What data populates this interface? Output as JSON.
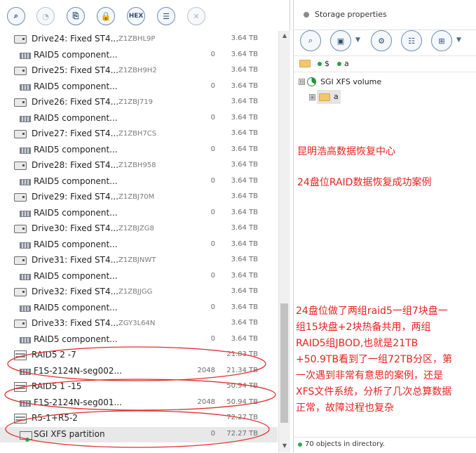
{
  "left_toolbar": {
    "buttons": [
      {
        "name": "search-button",
        "glyph": "⌕"
      },
      {
        "name": "chart-button",
        "glyph": "◔"
      },
      {
        "name": "image-button",
        "glyph": "⎘"
      },
      {
        "name": "lock-button",
        "glyph": "🔒"
      },
      {
        "name": "hex-button",
        "glyph": "HEX"
      },
      {
        "name": "list-button",
        "glyph": "☰"
      },
      {
        "name": "close-button",
        "glyph": "✕"
      }
    ]
  },
  "device_list": [
    {
      "kind": "drive",
      "name": "Drive24: Fixed ST4...",
      "serial": "Z1ZBHL9P",
      "num": "",
      "size": "3.64 TB"
    },
    {
      "kind": "component",
      "name": "RAID5 component...",
      "serial": "",
      "num": "0",
      "size": "3.64 TB"
    },
    {
      "kind": "drive",
      "name": "Drive25: Fixed ST4...",
      "serial": "Z1ZBH9H2",
      "num": "",
      "size": "3.64 TB"
    },
    {
      "kind": "component",
      "name": "RAID5 component...",
      "serial": "",
      "num": "0",
      "size": "3.64 TB"
    },
    {
      "kind": "drive",
      "name": "Drive26: Fixed ST4...",
      "serial": "Z1ZBJ719",
      "num": "",
      "size": "3.64 TB"
    },
    {
      "kind": "component",
      "name": "RAID5 component...",
      "serial": "",
      "num": "0",
      "size": "3.64 TB"
    },
    {
      "kind": "drive",
      "name": "Drive27: Fixed ST4...",
      "serial": "Z1ZBH7CS",
      "num": "",
      "size": "3.64 TB"
    },
    {
      "kind": "component",
      "name": "RAID5 component...",
      "serial": "",
      "num": "0",
      "size": "3.64 TB"
    },
    {
      "kind": "drive",
      "name": "Drive28: Fixed ST4...",
      "serial": "Z1ZBH958",
      "num": "",
      "size": "3.64 TB"
    },
    {
      "kind": "component",
      "name": "RAID5 component...",
      "serial": "",
      "num": "0",
      "size": "3.64 TB"
    },
    {
      "kind": "drive",
      "name": "Drive29: Fixed ST4...",
      "serial": "Z1ZBJ70M",
      "num": "",
      "size": "3.64 TB"
    },
    {
      "kind": "component",
      "name": "RAID5 component...",
      "serial": "",
      "num": "0",
      "size": "3.64 TB"
    },
    {
      "kind": "drive",
      "name": "Drive30: Fixed ST4...",
      "serial": "Z1ZBJZG8",
      "num": "",
      "size": "3.64 TB"
    },
    {
      "kind": "component",
      "name": "RAID5 component...",
      "serial": "",
      "num": "0",
      "size": "3.64 TB"
    },
    {
      "kind": "drive",
      "name": "Drive31: Fixed ST4...",
      "serial": "Z1ZBJNWT",
      "num": "",
      "size": "3.64 TB"
    },
    {
      "kind": "component",
      "name": "RAID5 component...",
      "serial": "",
      "num": "0",
      "size": "3.64 TB"
    },
    {
      "kind": "drive",
      "name": "Drive32: Fixed ST4...",
      "serial": "Z1ZBJJGG",
      "num": "",
      "size": "3.64 TB"
    },
    {
      "kind": "component",
      "name": "RAID5 component...",
      "serial": "",
      "num": "0",
      "size": "3.64 TB"
    },
    {
      "kind": "drive",
      "name": "Drive33: Fixed ST4...",
      "serial": "ZGY3L64N",
      "num": "",
      "size": "3.64 TB"
    },
    {
      "kind": "component",
      "name": "RAID5 component...",
      "serial": "",
      "num": "0",
      "size": "3.64 TB"
    },
    {
      "kind": "raid",
      "name": "RAID5 2 -7",
      "serial": "",
      "num": "",
      "size": "21.83 TB"
    },
    {
      "kind": "component",
      "name": "F1S-2124N-seg002...",
      "serial": "",
      "num": "2048",
      "size": "21.34 TB"
    },
    {
      "kind": "raid",
      "name": "RAID5 1 -15",
      "serial": "",
      "num": "",
      "size": "50.94 TB"
    },
    {
      "kind": "component",
      "name": "F1S-2124N-seg001...",
      "serial": "",
      "num": "2048",
      "size": "50.94 TB"
    },
    {
      "kind": "raid",
      "name": "R5-1+R5-2",
      "serial": "",
      "num": "",
      "size": "72.27 TB"
    },
    {
      "kind": "partition",
      "name": "SGI XFS partition",
      "serial": "",
      "num": "0",
      "size": "72.27 TB"
    }
  ],
  "right_panel": {
    "title": "Storage properties",
    "path": [
      "$",
      "a"
    ],
    "tree": {
      "root_label": "SGI XFS volume",
      "child_label": "a",
      "root_expander": "⊟",
      "child_expander": "⊞"
    },
    "notes": [
      "昆明浩高数据恢复中心",
      "24盘位RAID数据恢复成功案例",
      "24盘位做了两组raid5一组7块盘一",
      "组15块盘+2块热备共用，两组",
      "RAID5组JBOD,也就是21TB",
      "+50.9TB看到了一组72TB分区，第",
      "一次遇到非常有意思的案例，还是",
      "XFS文件系统，分析了几次总算数据",
      "正常，故障过程也复杂"
    ],
    "status": "70 objects in directory."
  },
  "colors": {
    "note_red": "#e8201e",
    "annotation_red": "#e03030",
    "status_green": "#34a853"
  }
}
